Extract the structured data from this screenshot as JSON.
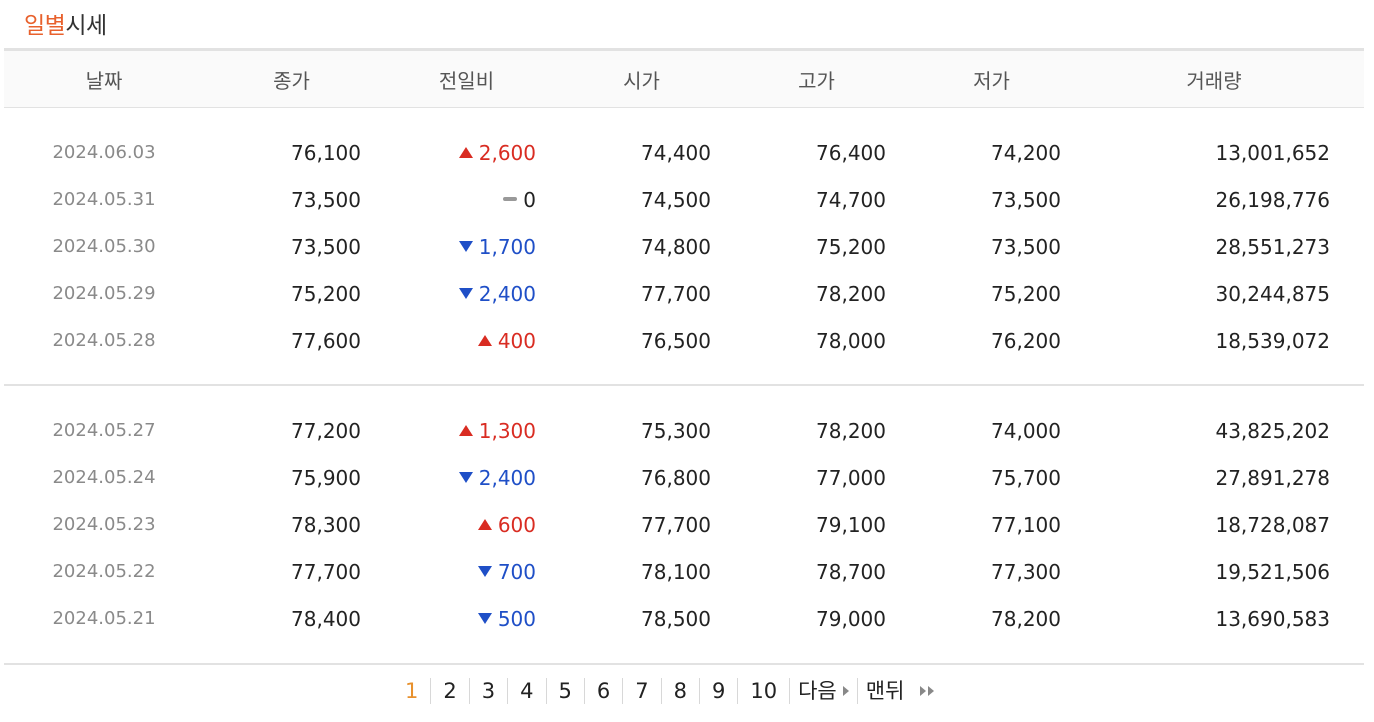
{
  "title": {
    "accent": "일별",
    "rest": "시세"
  },
  "columns": {
    "date": "날짜",
    "close": "종가",
    "diff": "전일비",
    "open": "시가",
    "high": "고가",
    "low": "저가",
    "volume": "거래량"
  },
  "groups": [
    {
      "rows": [
        {
          "date": "2024.06.03",
          "close": "76,100",
          "dir": "up",
          "diff": "2,600",
          "open": "74,400",
          "high": "76,400",
          "low": "74,200",
          "volume": "13,001,652"
        },
        {
          "date": "2024.05.31",
          "close": "73,500",
          "dir": "flat",
          "diff": "0",
          "open": "74,500",
          "high": "74,700",
          "low": "73,500",
          "volume": "26,198,776"
        },
        {
          "date": "2024.05.30",
          "close": "73,500",
          "dir": "down",
          "diff": "1,700",
          "open": "74,800",
          "high": "75,200",
          "low": "73,500",
          "volume": "28,551,273"
        },
        {
          "date": "2024.05.29",
          "close": "75,200",
          "dir": "down",
          "diff": "2,400",
          "open": "77,700",
          "high": "78,200",
          "low": "75,200",
          "volume": "30,244,875"
        },
        {
          "date": "2024.05.28",
          "close": "77,600",
          "dir": "up",
          "diff": "400",
          "open": "76,500",
          "high": "78,000",
          "low": "76,200",
          "volume": "18,539,072"
        }
      ]
    },
    {
      "rows": [
        {
          "date": "2024.05.27",
          "close": "77,200",
          "dir": "up",
          "diff": "1,300",
          "open": "75,300",
          "high": "78,200",
          "low": "74,000",
          "volume": "43,825,202"
        },
        {
          "date": "2024.05.24",
          "close": "75,900",
          "dir": "down",
          "diff": "2,400",
          "open": "76,800",
          "high": "77,000",
          "low": "75,700",
          "volume": "27,891,278"
        },
        {
          "date": "2024.05.23",
          "close": "78,300",
          "dir": "up",
          "diff": "600",
          "open": "77,700",
          "high": "79,100",
          "low": "77,100",
          "volume": "18,728,087"
        },
        {
          "date": "2024.05.22",
          "close": "77,700",
          "dir": "down",
          "diff": "700",
          "open": "78,100",
          "high": "78,700",
          "low": "77,300",
          "volume": "19,521,506"
        },
        {
          "date": "2024.05.21",
          "close": "78,400",
          "dir": "down",
          "diff": "500",
          "open": "78,500",
          "high": "79,000",
          "low": "78,200",
          "volume": "13,690,583"
        }
      ]
    }
  ],
  "pagination": {
    "pages": [
      "1",
      "2",
      "3",
      "4",
      "5",
      "6",
      "7",
      "8",
      "9",
      "10"
    ],
    "current": "1",
    "next_label": "다음",
    "last_label": "맨뒤"
  },
  "colors": {
    "accent": "#e8612d",
    "up": "#d92c22",
    "down": "#1f4fc7",
    "current_page": "#e8912d"
  }
}
